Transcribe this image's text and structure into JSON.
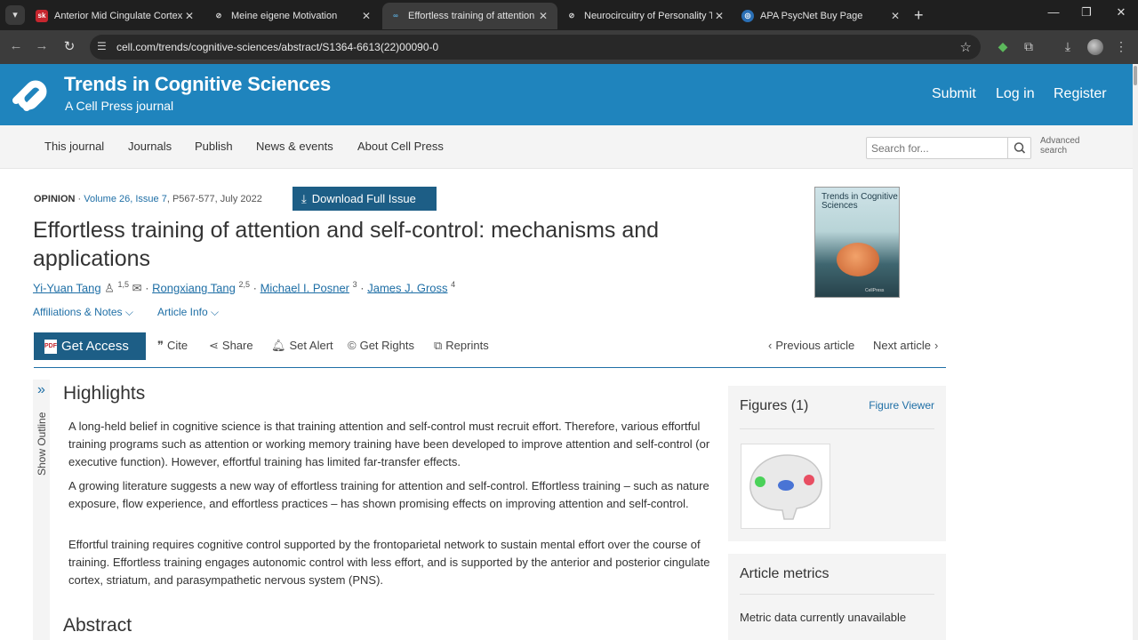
{
  "browser": {
    "tabs": [
      {
        "title": "Anterior Mid Cingulate Cortex",
        "favicon": "sk",
        "active": false
      },
      {
        "title": "Meine eigene Motivation",
        "favicon": "link-icon",
        "active": false
      },
      {
        "title": "Effortless training of attention",
        "favicon": "cellpress-icon",
        "active": true
      },
      {
        "title": "Neurocircuitry of Personality T",
        "favicon": "link-icon",
        "active": false
      },
      {
        "title": "APA PsycNet Buy Page",
        "favicon": "apa-icon",
        "active": false
      }
    ],
    "url": "cell.com/trends/cognitive-sciences/abstract/S1364-6613(22)00090-0"
  },
  "header": {
    "title": "Trends in Cognitive Sciences",
    "subtitle": "A Cell Press journal",
    "links": [
      "Submit",
      "Log in",
      "Register"
    ]
  },
  "subnav": {
    "items": [
      "This journal",
      "Journals",
      "Publish",
      "News & events",
      "About Cell Press"
    ],
    "search_placeholder": "Search for...",
    "advanced": "Advanced search"
  },
  "article": {
    "type": "OPINION",
    "volume": "Volume 26, Issue 7",
    "pages_date": "P567-577, July 2022",
    "download_label": "Download Full Issue",
    "title": "Effortless training of attention and self-control: mechanisms and applications",
    "authors": [
      {
        "name": "Yi-Yuan Tang",
        "sup": "1,5"
      },
      {
        "name": "Rongxiang Tang",
        "sup": "2,5"
      },
      {
        "name": "Michael I. Posner",
        "sup": "3"
      },
      {
        "name": "James J. Gross",
        "sup": "4"
      }
    ],
    "affiliations_label": "Affiliations & Notes",
    "article_info_label": "Article Info",
    "cover_title": "Trends in Cognitive Sciences"
  },
  "actions": {
    "get_access": "Get Access",
    "cite": "Cite",
    "share": "Share",
    "set_alert": "Set Alert",
    "get_rights": "Get Rights",
    "reprints": "Reprints",
    "previous": "Previous article",
    "next": "Next article"
  },
  "outline": {
    "label": "Show Outline"
  },
  "content": {
    "highlights_heading": "Highlights",
    "highlights": [
      "A long-held belief in cognitive science is that training attention and self-control must recruit effort. Therefore, various effortful training programs such as attention or working memory training have been developed to improve attention and self-control (or executive function). However, effortful training has limited far-transfer effects.",
      "A growing literature suggests a new way of effortless training for attention and self-control. Effortless training – such as nature exposure, flow experience, and effortless practices – has shown promising effects on improving attention and self-control.",
      "Effortful training requires cognitive control supported by the frontoparietal network to sustain mental effort over the course of training. Effortless training engages autonomic control with less effort, and is supported by the anterior and posterior cingulate cortex, striatum, and parasympathetic nervous system (PNS)."
    ],
    "abstract_heading": "Abstract"
  },
  "sidebar": {
    "figures_heading": "Figures (1)",
    "figure_viewer": "Figure Viewer",
    "metrics_heading": "Article metrics",
    "metrics_text": "Metric data currently unavailable"
  },
  "colors": {
    "brand": "#1f84bd",
    "button": "#1d5e86",
    "link": "#1f6fa6"
  }
}
